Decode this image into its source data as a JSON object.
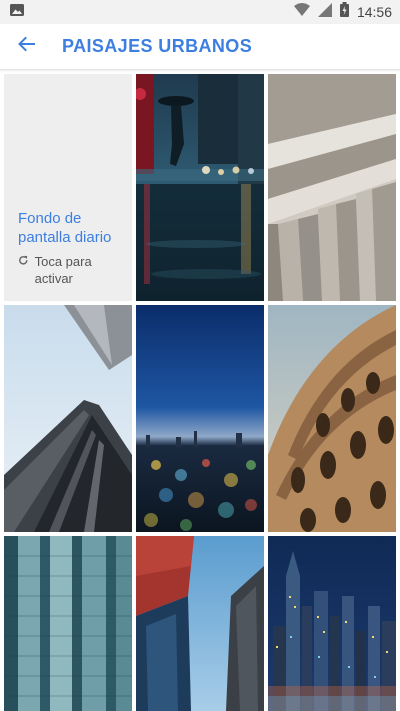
{
  "status_bar": {
    "time": "14:56",
    "icons": [
      "image-notification-icon",
      "wifi-icon",
      "battery-icon",
      "signal-icon"
    ]
  },
  "header": {
    "title": "PAISAJES URBANOS",
    "back_icon": "arrow-back-icon"
  },
  "daily_wallpaper": {
    "title": "Fondo de pantalla diario",
    "subtitle": "Toca para activar",
    "icon": "refresh-icon"
  },
  "wallpapers": [
    {
      "subject": "rainy-street"
    },
    {
      "subject": "concrete-arches"
    },
    {
      "subject": "skyscrapers-looking-up"
    },
    {
      "subject": "city-lights-bokeh"
    },
    {
      "subject": "colosseum"
    },
    {
      "subject": "glass-tower-facade"
    },
    {
      "subject": "towers-against-sky"
    },
    {
      "subject": "night-skyline"
    }
  ],
  "colors": {
    "accent": "#3c7fe0",
    "status_bar": "#f2f2f2",
    "tile_bg": "#eeeeee"
  }
}
